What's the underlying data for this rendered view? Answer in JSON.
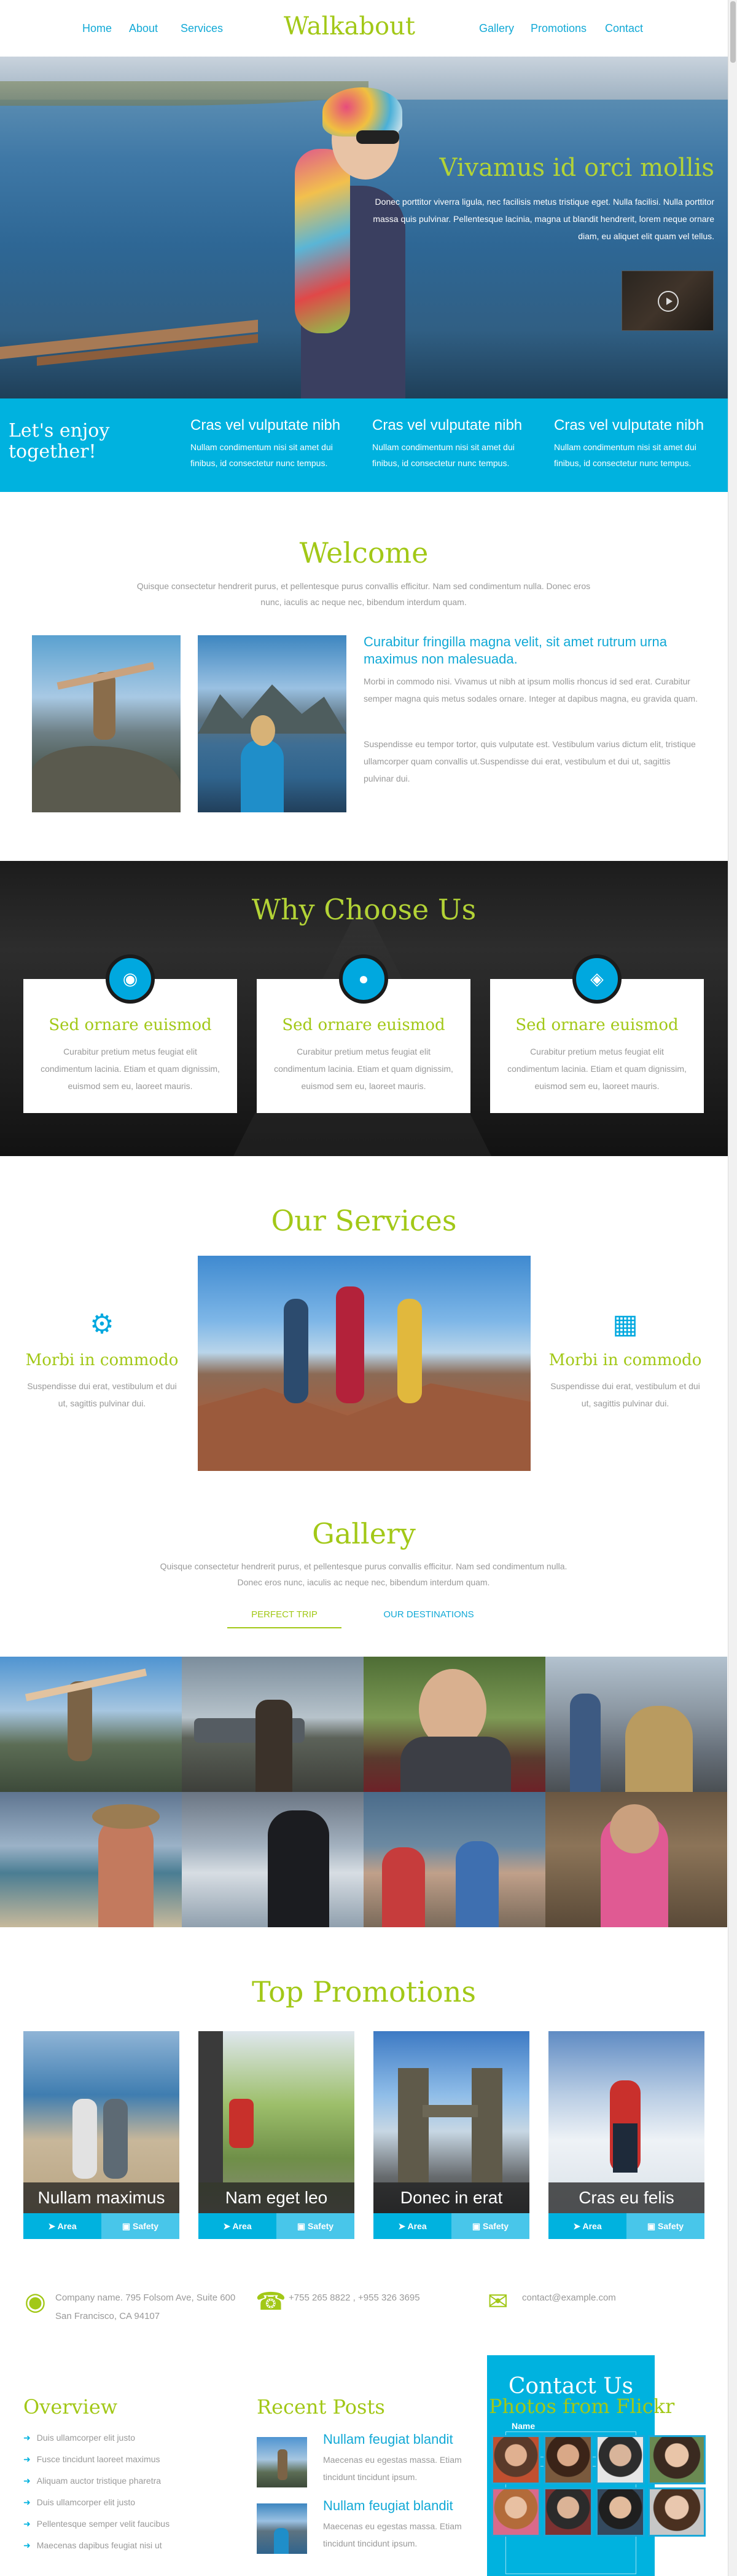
{
  "nav": {
    "logo": "Walkabout",
    "left": [
      "Home",
      "About",
      "Services"
    ],
    "right": [
      "Gallery",
      "Promotions",
      "Contact"
    ]
  },
  "hero": {
    "title": "Vivamus id orci mollis",
    "text": "Donec porttitor viverra ligula, nec facilisis metus tristique eget. Nulla facilisi. Nulla porttitor massa quis pulvinar. Pellentesque lacinia, magna ut blandit hendrerit, lorem neque ornare diam, eu aliquet elit quam vel tellus."
  },
  "bluebar": {
    "headline": "Let's enjoy together!",
    "items": [
      {
        "title": "Cras vel vulputate nibh",
        "text": "Nullam condimentum nisi sit amet dui finibus, id consectetur nunc tempus."
      },
      {
        "title": "Cras vel vulputate nibh",
        "text": "Nullam condimentum nisi sit amet dui finibus, id consectetur nunc tempus."
      },
      {
        "title": "Cras vel vulputate nibh",
        "text": "Nullam condimentum nisi sit amet dui finibus, id consectetur nunc tempus."
      }
    ]
  },
  "welcome": {
    "title": "Welcome",
    "intro": "Quisque consectetur hendrerit purus, et pellentesque purus convallis efficitur. Nam sed condimentum nulla. Donec eros nunc, iaculis ac neque nec, bibendum interdum quam.",
    "heading": "Curabitur fringilla magna velit, sit amet rutrum urna maximus non malesuada.",
    "p1": "Morbi in commodo nisi. Vivamus ut nibh at ipsum mollis rhoncus id sed erat. Curabitur semper magna quis metus sodales ornare. Integer at dapibus magna, eu gravida quam.",
    "p2": "Suspendisse eu tempor tortor, quis vulputate est. Vestibulum varius dictum elit, tristique ullamcorper quam convallis ut.Suspendisse dui erat, vestibulum et dui ut, sagittis pulvinar dui."
  },
  "why": {
    "title": "Why Choose Us",
    "cards": [
      {
        "icon": "globe-icon",
        "title": "Sed ornare euismod",
        "text": "Curabitur pretium metus feugiat elit condimentum lacinia. Etiam et quam dignissim, euismod sem eu, laoreet mauris."
      },
      {
        "icon": "lightbulb-icon",
        "title": "Sed ornare euismod",
        "text": "Curabitur pretium metus feugiat elit condimentum lacinia. Etiam et quam dignissim, euismod sem eu, laoreet mauris."
      },
      {
        "icon": "piggy-bank-icon",
        "title": "Sed ornare euismod",
        "text": "Curabitur pretium metus feugiat elit condimentum lacinia. Etiam et quam dignissim, euismod sem eu, laoreet mauris."
      }
    ]
  },
  "services": {
    "title": "Our Services",
    "left": {
      "icon": "gear-icon",
      "title": "Morbi in commodo",
      "text": "Suspendisse dui erat, vestibulum et dui ut, sagittis pulvinar dui."
    },
    "right": {
      "icon": "calendar-icon",
      "title": "Morbi in commodo",
      "text": "Suspendisse dui erat, vestibulum et dui ut, sagittis pulvinar dui."
    }
  },
  "gallery": {
    "title": "Gallery",
    "intro": "Quisque consectetur hendrerit purus, et pellentesque purus convallis efficitur. Nam sed condimentum nulla. Donec eros nunc, iaculis ac neque nec, bibendum interdum quam.",
    "tabs": [
      "PERFECT TRIP",
      "OUR DESTINATIONS"
    ]
  },
  "promotions": {
    "title": "Top Promotions",
    "items": [
      {
        "caption": "Nullam maximus",
        "left": "Area",
        "right": "Safety"
      },
      {
        "caption": "Nam eget leo",
        "left": "Area",
        "right": "Safety"
      },
      {
        "caption": "Donec in erat",
        "left": "Area",
        "right": "Safety"
      },
      {
        "caption": "Cras eu felis",
        "left": "Area",
        "right": "Safety"
      }
    ]
  },
  "contact": {
    "address": "Company name. 795 Folsom Ave, Suite 600 San Francisco, CA 94107",
    "phone": "+755 265 8822 , +955 326 3695",
    "email": "contact@example.com"
  },
  "footer": {
    "overview_title": "Overview",
    "overview_links": [
      "Duis ullamcorper elit justo",
      "Fusce tincidunt laoreet maximus",
      "Aliquam auctor tristique pharetra",
      "Duis ullamcorper elit justo",
      "Pellentesque semper velit faucibus",
      "Maecenas dapibus feugiat nisi ut"
    ],
    "recent_title": "Recent Posts",
    "posts": [
      {
        "title": "Nullam feugiat blandit",
        "text": "Maecenas eu egestas massa. Etiam tincidunt tincidunt ipsum."
      },
      {
        "title": "Nullam feugiat blandit",
        "text": "Maecenas eu egestas massa. Etiam tincidunt tincidunt ipsum."
      }
    ],
    "contact_title": "Contact Us",
    "name_label": "Name",
    "flickr_title": "Photos from Flickr"
  },
  "colors": {
    "accent_green": "#a2c817",
    "accent_blue": "#00b2df",
    "link_blue": "#12a9d6"
  }
}
